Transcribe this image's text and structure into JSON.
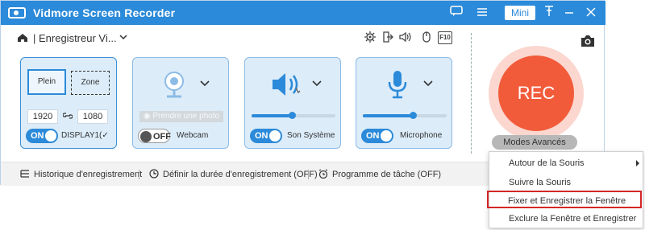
{
  "window": {
    "title": "Vidmore Screen Recorder",
    "mini_label": "Mini"
  },
  "header": {
    "breadcrumb": "| Enregistreur Vi...",
    "fi_label": "F10"
  },
  "display_panel": {
    "full_label": "Plein",
    "region_label": "Zone",
    "width_value": "1920",
    "height_value": "1080",
    "toggle": "ON",
    "device_label": "DISPLAY1(✓"
  },
  "webcam_panel": {
    "photo_label": "Prendre une photo",
    "toggle": "OFF",
    "label": "Webcam"
  },
  "sound_panel": {
    "toggle": "ON",
    "label": "Son Système",
    "level": 0.48
  },
  "mic_panel": {
    "toggle": "ON",
    "label": "Microphone",
    "level": 0.6
  },
  "rec": {
    "label": "REC",
    "modes_label": "Modes Avancés"
  },
  "bottom_bar": {
    "history": "Historique d'enregistrement",
    "duration": "Définir la durée d'enregistrement (OFF)",
    "schedule": "Programme de tâche (OFF)"
  },
  "menu": {
    "items": [
      "Autour de la Souris",
      "Suivre la Souris",
      "Fixer et Enregistrer la Fenêtre",
      "Exclure la Fenêtre et Enregistrer"
    ],
    "highlighted_index": 2
  },
  "colors": {
    "accent": "#2b8ad9",
    "rec": "#f25b3a",
    "highlight_border": "#d42626",
    "panel_bg": "#dcecf9"
  }
}
